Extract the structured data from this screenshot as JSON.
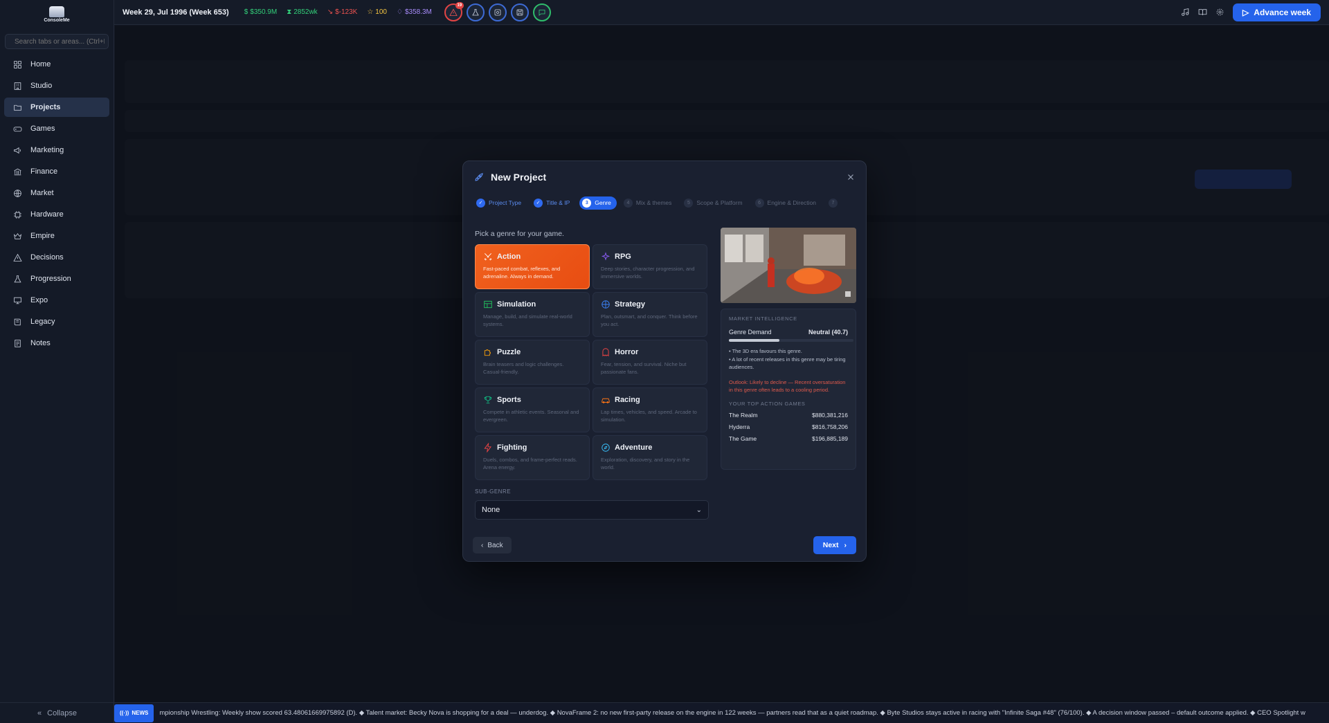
{
  "app": {
    "logo_text": "ConsoleMe"
  },
  "sidebar": {
    "search_placeholder": "Search tabs or areas... (Ctrl+K)",
    "items": [
      {
        "label": "Home",
        "icon": "grid-icon"
      },
      {
        "label": "Studio",
        "icon": "building-icon"
      },
      {
        "label": "Projects",
        "icon": "folder-icon",
        "active": true
      },
      {
        "label": "Games",
        "icon": "gamepad-icon"
      },
      {
        "label": "Marketing",
        "icon": "megaphone-icon"
      },
      {
        "label": "Finance",
        "icon": "bank-icon"
      },
      {
        "label": "Market",
        "icon": "globe-icon"
      },
      {
        "label": "Hardware",
        "icon": "chip-icon"
      },
      {
        "label": "Empire",
        "icon": "crown-icon"
      },
      {
        "label": "Decisions",
        "icon": "alert-icon"
      },
      {
        "label": "Progression",
        "icon": "flask-icon"
      },
      {
        "label": "Expo",
        "icon": "monitor-icon"
      },
      {
        "label": "Legacy",
        "icon": "book-icon"
      },
      {
        "label": "Notes",
        "icon": "notes-icon"
      }
    ],
    "collapse_label": "Collapse"
  },
  "topbar": {
    "week": "Week 29, Jul 1996 (Week 653)",
    "stats": [
      {
        "text": "$350.9M",
        "color": "#33d17a"
      },
      {
        "text": "2852wk",
        "color": "#33d17a"
      },
      {
        "text": "$-123K",
        "color": "#ef5350"
      },
      {
        "text": "100",
        "color": "#f5c542"
      },
      {
        "text": "$358.3M",
        "color": "#a78bfa"
      }
    ],
    "alerts_badge": "19",
    "advance_label": "Advance week"
  },
  "modal": {
    "title": "New Project",
    "steps": [
      {
        "num": "1",
        "label": "Project Type",
        "state": "done"
      },
      {
        "num": "2",
        "label": "Title & IP",
        "state": "done"
      },
      {
        "num": "3",
        "label": "Genre",
        "state": "active"
      },
      {
        "num": "4",
        "label": "Mix & themes",
        "state": "todo"
      },
      {
        "num": "5",
        "label": "Scope & Platform",
        "state": "todo"
      },
      {
        "num": "6",
        "label": "Engine & Direction",
        "state": "todo"
      },
      {
        "num": "7",
        "label": "",
        "state": "todo"
      }
    ],
    "prompt": "Pick a genre for your game.",
    "genres": [
      {
        "name": "Action",
        "desc": "Fast-paced combat, reflexes, and adrenaline. Always in demand.",
        "icon": "swords-icon",
        "color": "#ffffff",
        "selected": true
      },
      {
        "name": "RPG",
        "desc": "Deep stories, character progression, and immersive worlds.",
        "icon": "sparkles-icon",
        "color": "#8b5cf6"
      },
      {
        "name": "Simulation",
        "desc": "Manage, build, and simulate real-world systems.",
        "icon": "chart-icon",
        "color": "#22c55e"
      },
      {
        "name": "Strategy",
        "desc": "Plan, outsmart, and conquer. Think before you act.",
        "icon": "compass-icon",
        "color": "#3b82f6"
      },
      {
        "name": "Puzzle",
        "desc": "Brain teasers and logic challenges. Casual-friendly.",
        "icon": "puzzle-icon",
        "color": "#f59e0b"
      },
      {
        "name": "Horror",
        "desc": "Fear, tension, and survival. Niche but passionate fans.",
        "icon": "ghost-icon",
        "color": "#ef4444"
      },
      {
        "name": "Sports",
        "desc": "Compete in athletic events. Seasonal and evergreen.",
        "icon": "trophy-icon",
        "color": "#10b981"
      },
      {
        "name": "Racing",
        "desc": "Lap times, vehicles, and speed. Arcade to simulation.",
        "icon": "car-icon",
        "color": "#f97316"
      },
      {
        "name": "Fighting",
        "desc": "Duels, combos, and frame-perfect reads. Arena energy.",
        "icon": "bolt-icon",
        "color": "#ef4444"
      },
      {
        "name": "Adventure",
        "desc": "Exploration, discovery, and story in the world.",
        "icon": "compass-icon",
        "color": "#38bdf8"
      }
    ],
    "subgenre_label": "SUB-GENRE",
    "subgenre_value": "None",
    "intel": {
      "header": "MARKET INTELLIGENCE",
      "demand_label": "Genre Demand",
      "demand_value": "Neutral (40.7)",
      "demand_level": 0.407,
      "bullets": [
        "• The 3D era favours this genre.",
        "• A lot of recent releases in this genre may be tiring audiences."
      ],
      "outlook": "Outlook: Likely to decline — Recent oversaturation in this genre often leads to a cooling period.",
      "top_header": "YOUR TOP ACTION GAMES",
      "top_games": [
        {
          "name": "The Realm",
          "value": "$880,381,216"
        },
        {
          "name": "Hyderra",
          "value": "$816,758,206"
        },
        {
          "name": "The Game",
          "value": "$196,885,189"
        }
      ]
    },
    "back_label": "Back",
    "next_label": "Next"
  },
  "ticker": {
    "badge": "NEWS",
    "text": "mpionship Wrestling: Weekly show scored 63.48061669975892 (D). ◆ Talent market: Becky Nova is shopping for a deal — underdog. ◆ NovaFrame 2: no new first-party release on the engine in 122 weeks — partners read that as a quiet roadmap. ◆ Byte Studios stays active in racing with \"Infinite Saga #48\" (76/100). ◆ A decision window passed – default outcome applied. ◆ CEO Spotlight w"
  }
}
